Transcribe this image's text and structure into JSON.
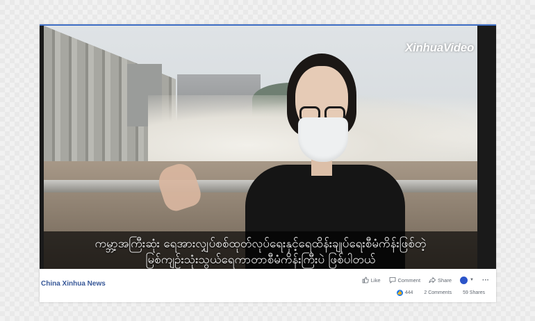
{
  "video": {
    "watermark": "XinhuaVideo",
    "subtitle_line1": "ကမ္ဘာ့အကြီးဆုံး ရေအားလျှပ်စစ်ထုတ်လုပ်ရေးနှင့်ရေထိန်းချုပ်ရေးစီမံကိန်းဖြစ်တဲ့",
    "subtitle_line2": "မြစ်ကျဉ်းသုံးသွယ်ရေကာတာစီမံကိန်းကြီးပဲ ဖြစ်ပါတယ်"
  },
  "footer": {
    "page_name": "China Xinhua News",
    "actions": {
      "like": "Like",
      "comment": "Comment",
      "share": "Share",
      "more": "···"
    },
    "stats": {
      "reactions": "444",
      "comments": "2 Comments",
      "shares": "59 Shares"
    }
  },
  "colors": {
    "accent": "#3f6fc6",
    "page_name": "#385898",
    "like_blue": "#1877f2"
  },
  "icons": [
    "thumbs-up-icon",
    "comment-icon",
    "share-icon",
    "avatar-icon",
    "chevron-down-icon",
    "more-icon",
    "like-reaction-icon"
  ]
}
